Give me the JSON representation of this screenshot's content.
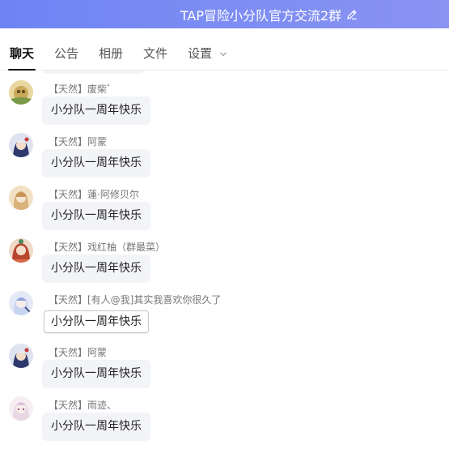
{
  "header": {
    "title": "TAP冒险小分队官方交流2群",
    "edit_icon": "pencil-icon",
    "background": "#7b8cf3"
  },
  "tabs": [
    {
      "label": "聊天",
      "active": true
    },
    {
      "label": "公告",
      "active": false
    },
    {
      "label": "相册",
      "active": false
    },
    {
      "label": "文件",
      "active": false
    },
    {
      "label": "设置",
      "active": false,
      "icon": "chevron-down-icon"
    }
  ],
  "messages": [
    {
      "sender": "【天然】废柴゛",
      "text": "小分队一周年快乐",
      "avatar_color": "#c9a85a"
    },
    {
      "sender": "【天然】阿蒙",
      "text": "小分队一周年快乐",
      "avatar_color": "#3a4a8c"
    },
    {
      "sender": "【天然】蓮·阿修贝尔",
      "text": "小分队一周年快乐",
      "avatar_color": "#d8b27a"
    },
    {
      "sender": "【天然】戏红柚（群最菜）",
      "text": "小分队一周年快乐",
      "avatar_color": "#c55a3a"
    },
    {
      "sender": "【天然】[有人@我]其实我喜欢你很久了",
      "text": "小分队一周年快乐",
      "avatar_color": "#8aa0d8",
      "outlined": true
    },
    {
      "sender": "【天然】阿蒙",
      "text": "小分队一周年快乐",
      "avatar_color": "#3a4a8c"
    },
    {
      "sender": "【天然】雨迹、",
      "text": "小分队一周年快乐",
      "avatar_color": "#e8c8d8"
    }
  ]
}
